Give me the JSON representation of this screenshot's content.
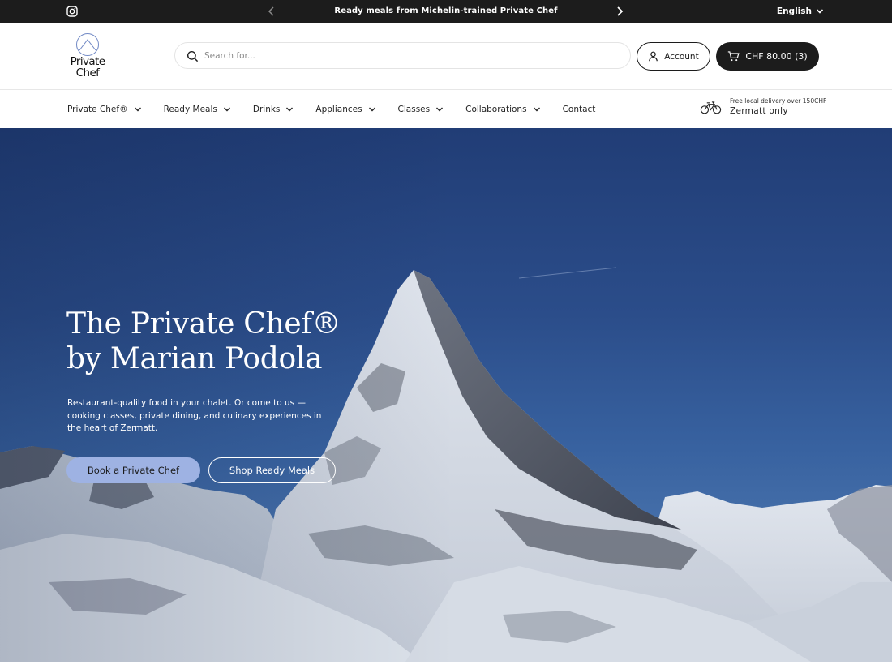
{
  "announcement": {
    "message": "Ready meals from Michelin-trained Private Chef",
    "language": "English"
  },
  "header": {
    "logo_line1": "Private",
    "logo_line2": "Chef",
    "search_placeholder": "Search for...",
    "account_label": "Account",
    "cart_label": "CHF 80.00 (3)"
  },
  "nav": {
    "items": [
      {
        "label": "Private Chef®",
        "dropdown": true
      },
      {
        "label": "Ready Meals",
        "dropdown": true
      },
      {
        "label": "Drinks",
        "dropdown": true
      },
      {
        "label": "Appliances",
        "dropdown": true
      },
      {
        "label": "Classes",
        "dropdown": true
      },
      {
        "label": "Collaborations",
        "dropdown": true
      },
      {
        "label": "Contact",
        "dropdown": false
      }
    ],
    "delivery_note": "Free local delivery over 150CHF",
    "delivery_area": "Zermatt only"
  },
  "hero": {
    "title_line1": "The Private Chef®",
    "title_line2": "by Marian Podola",
    "description": "Restaurant-quality food in your chalet. Or come to us — cooking classes, private dining, and culinary experiences in the heart of Zermatt.",
    "primary_button": "Book a Private Chef",
    "secondary_button": "Shop Ready Meals"
  },
  "icons": {
    "social": "instagram-icon",
    "prev": "chevron-left-icon",
    "next": "chevron-right-icon",
    "search": "search-icon",
    "account": "user-icon",
    "cart": "cart-icon",
    "delivery": "bicycle-icon"
  },
  "colors": {
    "topbar": "#1c1c1c",
    "primary_button": "#9eb2e3",
    "sky": "#2b4d8a"
  }
}
